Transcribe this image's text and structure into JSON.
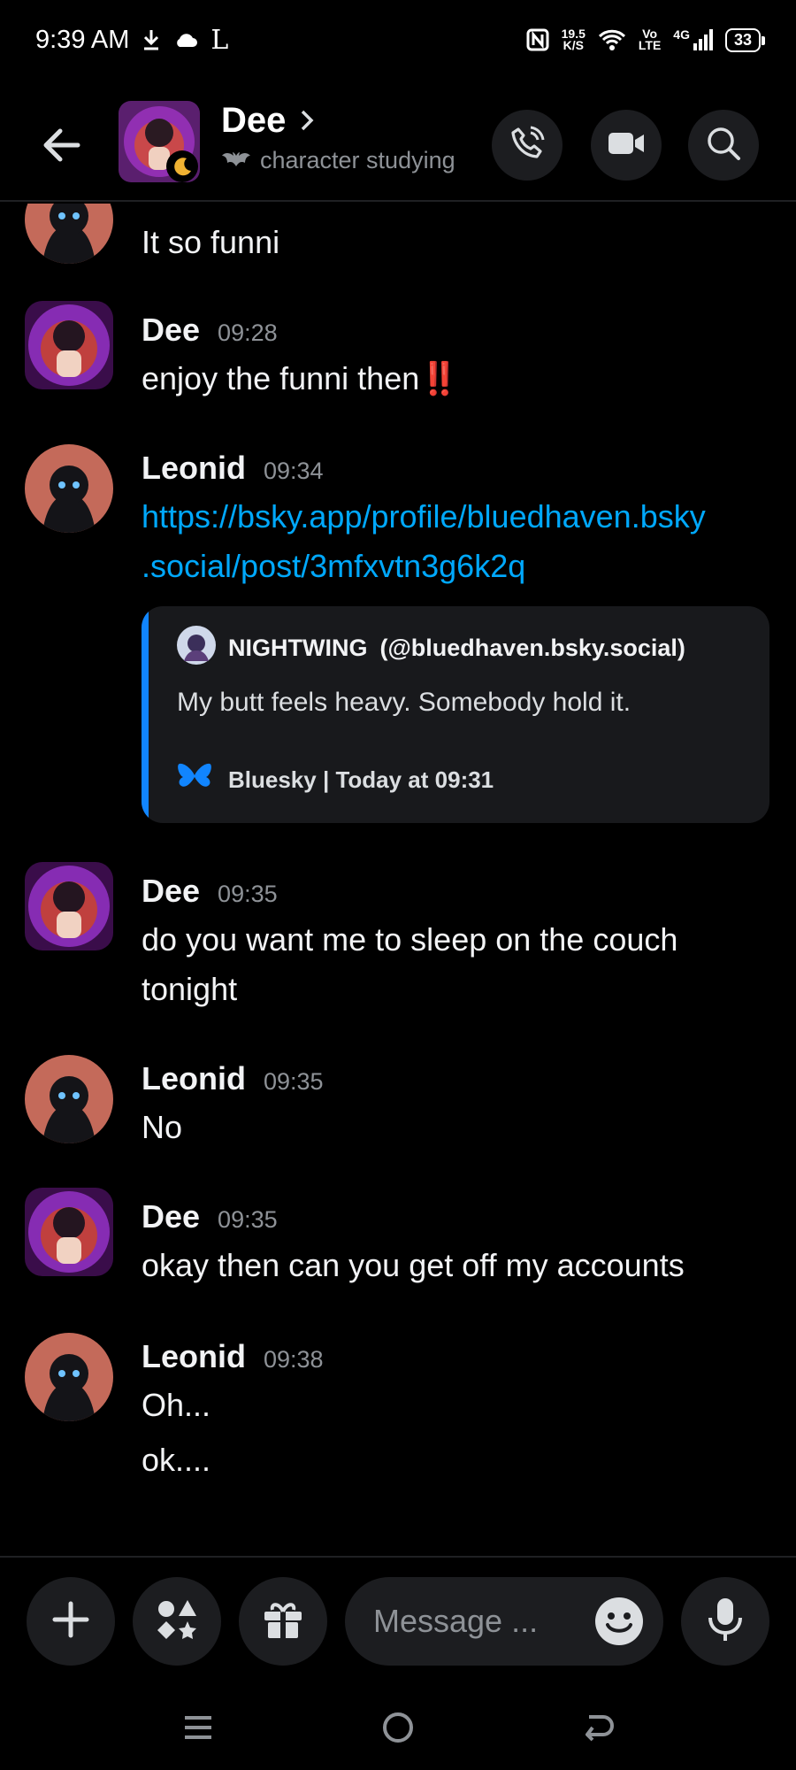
{
  "status_bar": {
    "time": "9:39 AM",
    "speed_value": "19.5",
    "speed_unit": "K/S",
    "volte_top": "Vo",
    "volte_bottom": "LTE",
    "network": "4G",
    "battery": "33",
    "left_extra_glyph": "L"
  },
  "header": {
    "name": "Dee",
    "status": "character studying",
    "call_icon": "phone-icon",
    "video_icon": "video-camera-icon",
    "search_icon": "search-icon"
  },
  "messages": [
    {
      "author": "",
      "time": "",
      "lines": [
        "It so funni"
      ]
    },
    {
      "author": "Dee",
      "time": "09:28",
      "lines": [
        "enjoy the funni then‼️"
      ]
    },
    {
      "author": "Leonid",
      "time": "09:34",
      "lines": [
        "https://bsky.app/profile/bluedhaven.bsky",
        ".social/post/3mfxvtn3g6k2q"
      ]
    },
    {
      "author": "Dee",
      "time": "09:35",
      "lines": [
        "do you want me to sleep on the couch",
        "tonight"
      ]
    },
    {
      "author": "Leonid",
      "time": "09:35",
      "lines": [
        "No"
      ]
    },
    {
      "author": "Dee",
      "time": "09:35",
      "lines": [
        "okay then can you get off my accounts"
      ]
    },
    {
      "author": "Leonid",
      "time": "09:38",
      "lines": [
        "Oh...",
        "ok...."
      ]
    }
  ],
  "embed": {
    "author_name": "NIGHTWING",
    "author_handle": "(@bluedhaven.bsky.social)",
    "description": "My butt feels heavy. Somebody hold it.",
    "footer": "Bluesky | Today at 09:31",
    "accent_color": "#1185fe"
  },
  "composer": {
    "placeholder": "Message ...",
    "add_icon": "plus-icon",
    "apps_icon": "apps-icon",
    "gift_icon": "gift-icon",
    "emoji_icon": "emoji-icon",
    "mic_icon": "microphone-icon"
  },
  "colors": {
    "background": "#000000",
    "link": "#00a8fc",
    "muted": "#8e9297",
    "surface": "#1c1d20"
  }
}
